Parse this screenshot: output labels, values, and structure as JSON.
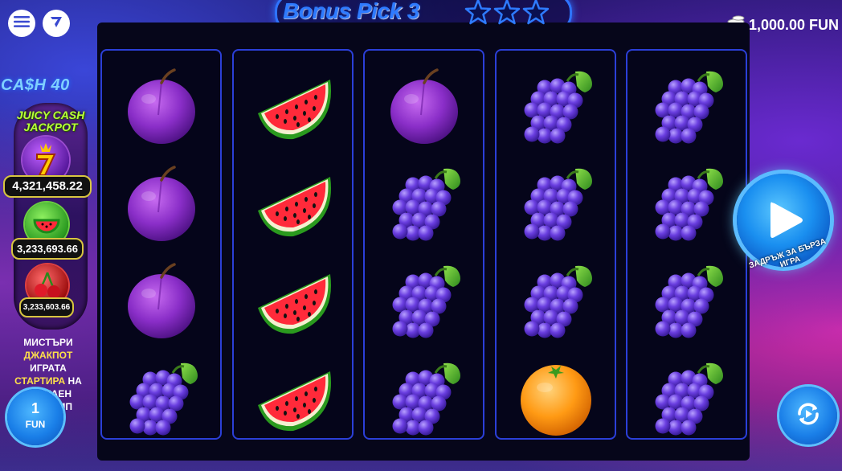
{
  "header": {
    "game_title": "Bonus Pick 3",
    "stars_count": 3,
    "balance": "1,000.00 FUN",
    "menu_icon": "hamburger-menu-icon",
    "brand_icon": "brand-logo-icon",
    "coins_icon": "coin-stack-icon"
  },
  "side": {
    "game_name": "CA$H 40",
    "jackpot_title_line1": "JUICY CASH",
    "jackpot_title_line2": "JACKPOT",
    "jackpots": [
      {
        "symbol": "seven",
        "value": "4,321,458.22"
      },
      {
        "symbol": "watermelon",
        "value": "3,233,693.66"
      },
      {
        "symbol": "cherry",
        "value": "3,233,603.66"
      }
    ],
    "mystery_line1_a": "МИСТЪРИ ",
    "mystery_line1_b": "ДЖАКПОТ",
    "mystery_line2_a": "ИГРАТА ",
    "mystery_line2_b": "СТАРТИРА",
    "mystery_line2_c": " НА",
    "mystery_line3": "СЛУЧАЕН ПРИНЦИП"
  },
  "reels": [
    [
      "plum",
      "plum",
      "plum",
      "grapes"
    ],
    [
      "watermelon",
      "watermelon",
      "watermelon",
      "watermelon"
    ],
    [
      "plum",
      "grapes",
      "grapes",
      "grapes"
    ],
    [
      "grapes",
      "grapes",
      "grapes",
      "orange"
    ],
    [
      "grapes",
      "grapes",
      "grapes",
      "grapes"
    ]
  ],
  "controls": {
    "spin_label": "ЗАДРЪЖ ЗА БЪРЗА ИГРА",
    "bet_value": "1",
    "bet_unit": "FUN",
    "spin_icon": "play-icon",
    "autoplay_icon": "autoplay-icon"
  },
  "colors": {
    "reel_border": "#2b3fd8",
    "accent_blue": "#2e7bff",
    "jackpot_green": "#b9ff3a",
    "jackpot_border": "#d8c640"
  }
}
